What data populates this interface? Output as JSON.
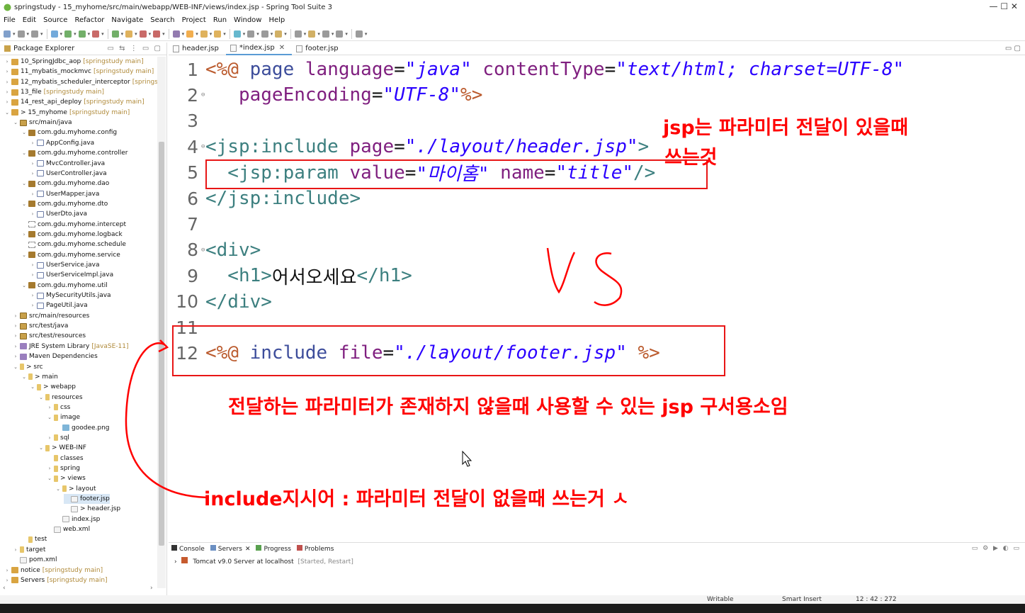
{
  "window": {
    "title": "springstudy - 15_myhome/src/main/webapp/WEB-INF/views/index.jsp - Spring Tool Suite 3",
    "controls": "—   ☐   ✕"
  },
  "menu": [
    "File",
    "Edit",
    "Source",
    "Refactor",
    "Navigate",
    "Search",
    "Project",
    "Run",
    "Window",
    "Help"
  ],
  "explorer": {
    "title": "Package Explorer",
    "items": [
      {
        "label": "10_SpringJdbc_aop",
        "dec": "[springstudy main]",
        "depth": 0,
        "tw": ">",
        "icon": "proj"
      },
      {
        "label": "11_mybatis_mockmvc",
        "dec": "[springstudy main]",
        "depth": 0,
        "tw": ">",
        "icon": "proj"
      },
      {
        "label": "12_mybatis_scheduler_interceptor",
        "dec": "[springstu",
        "depth": 0,
        "tw": ">",
        "icon": "proj"
      },
      {
        "label": "13_file",
        "dec": "[springstudy main]",
        "depth": 0,
        "tw": ">",
        "icon": "proj"
      },
      {
        "label": "14_rest_api_deploy",
        "dec": "[springstudy main]",
        "depth": 0,
        "tw": ">",
        "icon": "proj"
      },
      {
        "label": "> 15_myhome",
        "dec": "[springstudy main]",
        "depth": 0,
        "tw": "v",
        "icon": "proj"
      },
      {
        "label": "src/main/java",
        "dec": "",
        "depth": 1,
        "tw": "v",
        "icon": "srcf"
      },
      {
        "label": "com.gdu.myhome.config",
        "dec": "",
        "depth": 2,
        "tw": "v",
        "icon": "pkg"
      },
      {
        "label": "AppConfig.java",
        "dec": "",
        "depth": 3,
        "tw": ">",
        "icon": "java"
      },
      {
        "label": "com.gdu.myhome.controller",
        "dec": "",
        "depth": 2,
        "tw": "v",
        "icon": "pkg"
      },
      {
        "label": "MvcController.java",
        "dec": "",
        "depth": 3,
        "tw": ">",
        "icon": "java"
      },
      {
        "label": "UserController.java",
        "dec": "",
        "depth": 3,
        "tw": ">",
        "icon": "java"
      },
      {
        "label": "com.gdu.myhome.dao",
        "dec": "",
        "depth": 2,
        "tw": "v",
        "icon": "pkg"
      },
      {
        "label": "UserMapper.java",
        "dec": "",
        "depth": 3,
        "tw": ">",
        "icon": "java"
      },
      {
        "label": "com.gdu.myhome.dto",
        "dec": "",
        "depth": 2,
        "tw": "v",
        "icon": "pkg"
      },
      {
        "label": "UserDto.java",
        "dec": "",
        "depth": 3,
        "tw": ">",
        "icon": "java"
      },
      {
        "label": "com.gdu.myhome.intercept",
        "dec": "",
        "depth": 2,
        "tw": "",
        "icon": "empty"
      },
      {
        "label": "com.gdu.myhome.logback",
        "dec": "",
        "depth": 2,
        "tw": ">",
        "icon": "pkg"
      },
      {
        "label": "com.gdu.myhome.schedule",
        "dec": "",
        "depth": 2,
        "tw": "",
        "icon": "empty"
      },
      {
        "label": "com.gdu.myhome.service",
        "dec": "",
        "depth": 2,
        "tw": "v",
        "icon": "pkg"
      },
      {
        "label": "UserService.java",
        "dec": "",
        "depth": 3,
        "tw": ">",
        "icon": "java"
      },
      {
        "label": "UserServiceImpl.java",
        "dec": "",
        "depth": 3,
        "tw": ">",
        "icon": "java"
      },
      {
        "label": "com.gdu.myhome.util",
        "dec": "",
        "depth": 2,
        "tw": "v",
        "icon": "pkg"
      },
      {
        "label": "MySecurityUtils.java",
        "dec": "",
        "depth": 3,
        "tw": ">",
        "icon": "java"
      },
      {
        "label": "PageUtil.java",
        "dec": "",
        "depth": 3,
        "tw": ">",
        "icon": "java"
      },
      {
        "label": "src/main/resources",
        "dec": "",
        "depth": 1,
        "tw": ">",
        "icon": "srcf"
      },
      {
        "label": "src/test/java",
        "dec": "",
        "depth": 1,
        "tw": ">",
        "icon": "srcf"
      },
      {
        "label": "src/test/resources",
        "dec": "",
        "depth": 1,
        "tw": ">",
        "icon": "srcf"
      },
      {
        "label": "JRE System Library",
        "dec": "[JavaSE-11]",
        "depth": 1,
        "tw": ">",
        "icon": "lib"
      },
      {
        "label": "Maven Dependencies",
        "dec": "",
        "depth": 1,
        "tw": ">",
        "icon": "lib"
      },
      {
        "label": "> src",
        "dec": "",
        "depth": 1,
        "tw": "v",
        "icon": "fold"
      },
      {
        "label": "> main",
        "dec": "",
        "depth": 2,
        "tw": "v",
        "icon": "fold"
      },
      {
        "label": "> webapp",
        "dec": "",
        "depth": 3,
        "tw": "v",
        "icon": "fold"
      },
      {
        "label": "resources",
        "dec": "",
        "depth": 4,
        "tw": "v",
        "icon": "fold"
      },
      {
        "label": "css",
        "dec": "",
        "depth": 5,
        "tw": ">",
        "icon": "fold"
      },
      {
        "label": "image",
        "dec": "",
        "depth": 5,
        "tw": "v",
        "icon": "fold"
      },
      {
        "label": "goodee.png",
        "dec": "",
        "depth": 6,
        "tw": "",
        "icon": "img"
      },
      {
        "label": "sql",
        "dec": "",
        "depth": 5,
        "tw": ">",
        "icon": "fold"
      },
      {
        "label": "> WEB-INF",
        "dec": "",
        "depth": 4,
        "tw": "v",
        "icon": "fold"
      },
      {
        "label": "classes",
        "dec": "",
        "depth": 5,
        "tw": "",
        "icon": "fold"
      },
      {
        "label": "spring",
        "dec": "",
        "depth": 5,
        "tw": ">",
        "icon": "fold"
      },
      {
        "label": "> views",
        "dec": "",
        "depth": 5,
        "tw": "v",
        "icon": "fold"
      },
      {
        "label": "> layout",
        "dec": "",
        "depth": 6,
        "tw": "v",
        "icon": "fold"
      },
      {
        "label": "footer.jsp",
        "dec": "",
        "depth": 7,
        "tw": "",
        "icon": "file",
        "sel": true
      },
      {
        "label": "> header.jsp",
        "dec": "",
        "depth": 7,
        "tw": "",
        "icon": "file"
      },
      {
        "label": "index.jsp",
        "dec": "",
        "depth": 6,
        "tw": "",
        "icon": "file"
      },
      {
        "label": "web.xml",
        "dec": "",
        "depth": 5,
        "tw": "",
        "icon": "file"
      },
      {
        "label": "test",
        "dec": "",
        "depth": 2,
        "tw": "",
        "icon": "fold"
      },
      {
        "label": "target",
        "dec": "",
        "depth": 1,
        "tw": ">",
        "icon": "fold"
      },
      {
        "label": "pom.xml",
        "dec": "",
        "depth": 1,
        "tw": "",
        "icon": "file"
      },
      {
        "label": "notice",
        "dec": "[springstudy main]",
        "depth": 0,
        "tw": ">",
        "icon": "proj"
      },
      {
        "label": "Servers",
        "dec": "[springstudy main]",
        "depth": 0,
        "tw": ">",
        "icon": "proj"
      }
    ]
  },
  "editor": {
    "tabs": [
      {
        "label": "header.jsp",
        "active": false
      },
      {
        "label": "*index.jsp",
        "active": true,
        "closable": true
      },
      {
        "label": "footer.jsp",
        "active": false
      }
    ],
    "lines": [
      {
        "n": "1",
        "fold": "",
        "tokens": [
          {
            "c": "dir",
            "t": "<%@ "
          },
          {
            "c": "kw",
            "t": "page "
          },
          {
            "c": "attr",
            "t": "language"
          },
          {
            "c": "txt",
            "t": "="
          },
          {
            "c": "str",
            "t": "\"java\""
          },
          {
            "c": "attr",
            "t": " contentType"
          },
          {
            "c": "txt",
            "t": "="
          },
          {
            "c": "str",
            "t": "\"text/html; charset=UTF-8\""
          }
        ]
      },
      {
        "n": "2",
        "fold": "⊖",
        "tokens": [
          {
            "c": "attr",
            "t": "   pageEncoding"
          },
          {
            "c": "txt",
            "t": "="
          },
          {
            "c": "str",
            "t": "\"UTF-8\""
          },
          {
            "c": "dir",
            "t": "%>"
          }
        ]
      },
      {
        "n": "3",
        "fold": "",
        "tokens": []
      },
      {
        "n": "4",
        "fold": "⊖",
        "tokens": [
          {
            "c": "tag",
            "t": "<jsp:include "
          },
          {
            "c": "attr",
            "t": "page"
          },
          {
            "c": "txt",
            "t": "="
          },
          {
            "c": "str",
            "t": "\"./layout/header.jsp\""
          },
          {
            "c": "tag",
            "t": ">"
          }
        ]
      },
      {
        "n": "5",
        "fold": "",
        "tokens": [
          {
            "c": "tag",
            "t": "  <jsp:param "
          },
          {
            "c": "attr",
            "t": "value"
          },
          {
            "c": "txt",
            "t": "="
          },
          {
            "c": "str",
            "t": "\"마이홈\""
          },
          {
            "c": "attr",
            "t": " name"
          },
          {
            "c": "txt",
            "t": "="
          },
          {
            "c": "str",
            "t": "\"title\""
          },
          {
            "c": "tag",
            "t": "/>"
          }
        ]
      },
      {
        "n": "6",
        "fold": "",
        "tokens": [
          {
            "c": "tag",
            "t": "</jsp:include>"
          }
        ]
      },
      {
        "n": "7",
        "fold": "",
        "tokens": []
      },
      {
        "n": "8",
        "fold": "⊖",
        "tokens": [
          {
            "c": "tag",
            "t": "<div>"
          }
        ]
      },
      {
        "n": "9",
        "fold": "",
        "tokens": [
          {
            "c": "tag",
            "t": "  <h1>"
          },
          {
            "c": "txt",
            "t": "어서오세요"
          },
          {
            "c": "tag",
            "t": "</h1>"
          }
        ]
      },
      {
        "n": "10",
        "fold": "",
        "tokens": [
          {
            "c": "tag",
            "t": "</div>"
          }
        ]
      },
      {
        "n": "11",
        "fold": "",
        "tokens": []
      },
      {
        "n": "12",
        "fold": "",
        "tokens": [
          {
            "c": "dir",
            "t": "<%@ "
          },
          {
            "c": "kw",
            "t": "include "
          },
          {
            "c": "attr",
            "t": "file"
          },
          {
            "c": "txt",
            "t": "="
          },
          {
            "c": "str",
            "t": "\"./layout/footer.jsp\""
          },
          {
            "c": "dir",
            "t": " %>"
          }
        ]
      }
    ]
  },
  "annotations": {
    "a1_line1": "jsp는 파라미터 전달이 있을때",
    "a1_line2": "쓰는것",
    "vs": "VS",
    "a2": "전달하는 파라미터가 존재하지 않을때 사용할 수 있는 jsp 구서용소임",
    "a3": "include지시어 : 파라미터 전달이 없을때 쓰는거 ㅅ"
  },
  "bottom": {
    "tabs": [
      "Console",
      "Servers",
      "Progress",
      "Problems"
    ],
    "server": "Tomcat v9.0 Server at localhost",
    "server_state": "[Started, Restart]"
  },
  "status": {
    "mode": "Writable",
    "insert": "Smart Insert",
    "pos": "12 : 42 : 272"
  }
}
